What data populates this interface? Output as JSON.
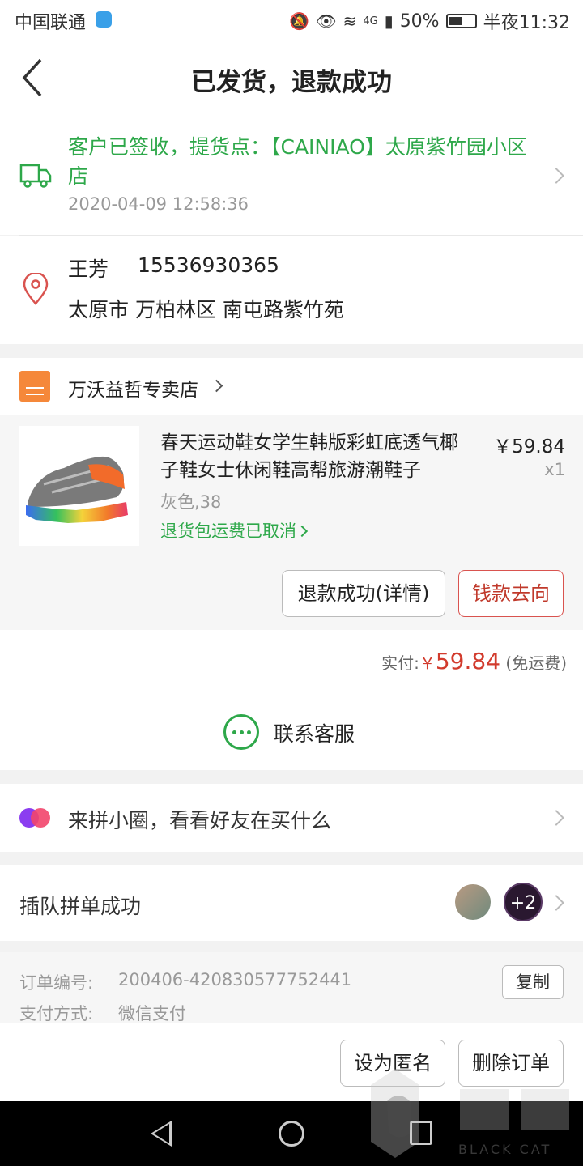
{
  "status_bar": {
    "carrier": "中国联通",
    "battery": "50%",
    "network": "4G",
    "time": "半夜11:32"
  },
  "header": {
    "title": "已发货，退款成功"
  },
  "logistics": {
    "message": "客户已签收，提货点：【CAINIAO】太原紫竹园小区店",
    "time": "2020-04-09 12:58:36"
  },
  "address": {
    "name": "王芳",
    "phone": "15536930365",
    "address": "太原市 万柏林区 南屯路紫竹苑"
  },
  "shop": {
    "name": "万沃益哲专卖店"
  },
  "goods": {
    "title": "春天运动鞋女学生韩版彩虹底透气椰子鞋女士休闲鞋高帮旅游潮鞋子",
    "price": "￥59.84",
    "quantity": "x1",
    "spec": "灰色,38",
    "shipping_note": "退货包运费已取消"
  },
  "actions": {
    "refund_detail": "退款成功(详情)",
    "money_flow": "钱款去向"
  },
  "payment": {
    "label": "实付:",
    "currency": "￥",
    "amount": "59.84",
    "shipping": "(免运费)"
  },
  "service": {
    "label": "联系客服"
  },
  "circle": {
    "label": "来拼小圈，看看好友在买什么"
  },
  "group": {
    "label": "插队拼单成功",
    "extra_count": "+2"
  },
  "order": {
    "number_label": "订单编号:",
    "number": "200406-420830577752441",
    "copy": "复制",
    "pay_label": "支付方式:",
    "pay_method": "微信支付"
  },
  "bottom_actions": {
    "anonymous": "设为匿名",
    "delete": "删除订单"
  },
  "watermark": {
    "text": "BLACK CAT"
  },
  "colors": {
    "green": "#2ea84a",
    "red": "#d23b2d",
    "orange": "#f5883a"
  }
}
